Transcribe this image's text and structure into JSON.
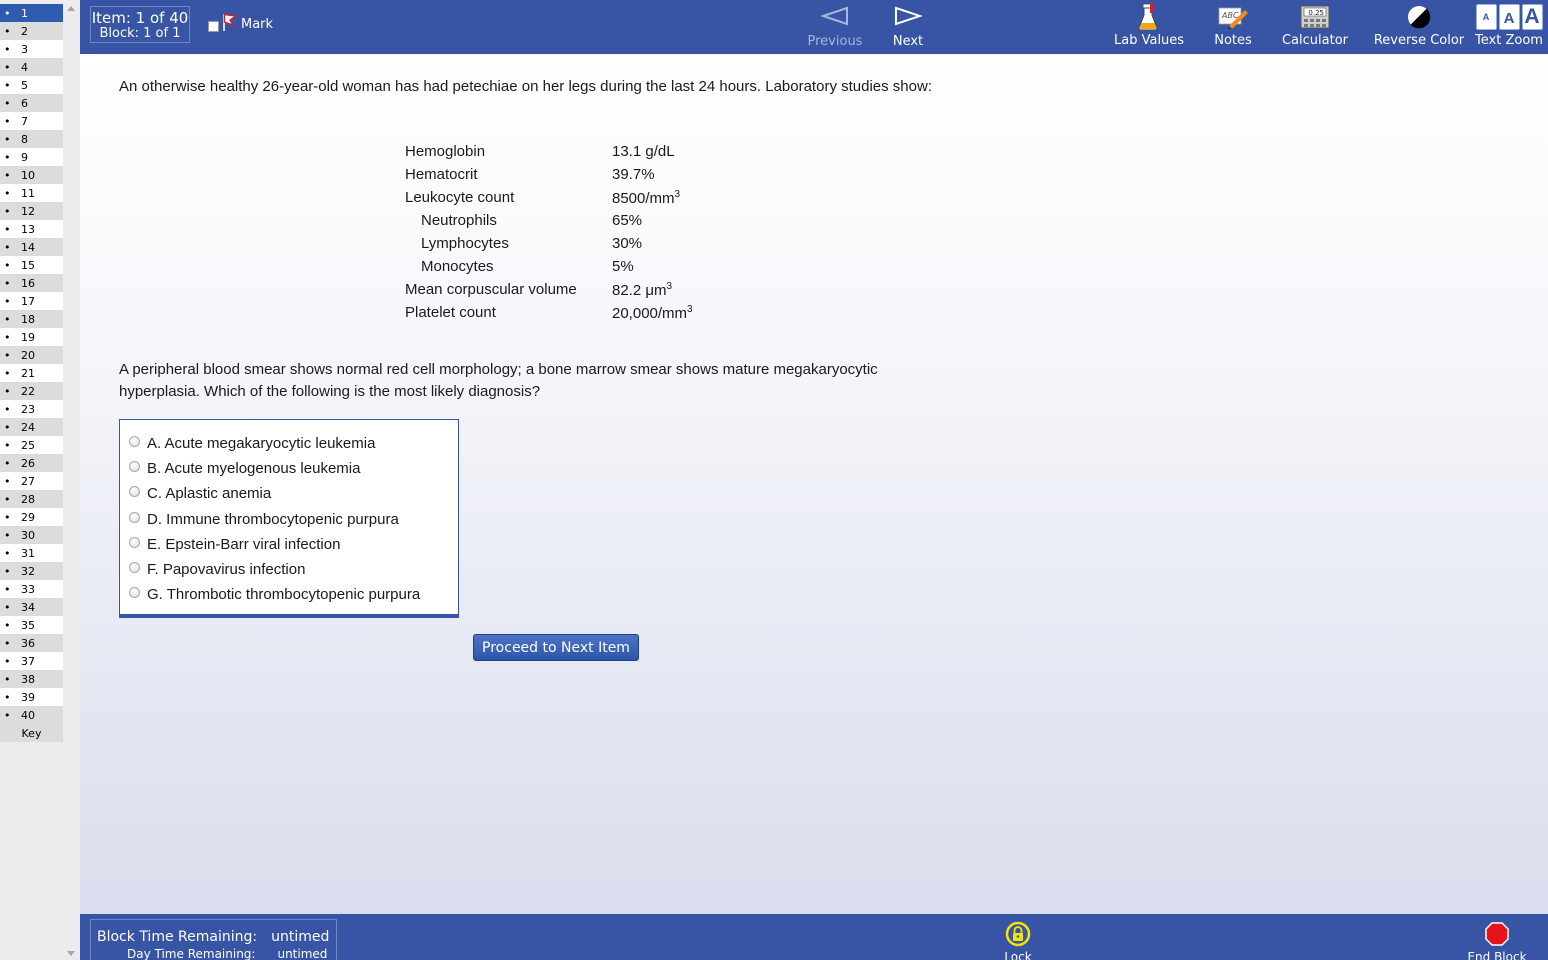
{
  "sidebar": {
    "items": [
      "1",
      "2",
      "3",
      "4",
      "5",
      "6",
      "7",
      "8",
      "9",
      "10",
      "11",
      "12",
      "13",
      "14",
      "15",
      "16",
      "17",
      "18",
      "19",
      "20",
      "21",
      "22",
      "23",
      "24",
      "25",
      "26",
      "27",
      "28",
      "29",
      "30",
      "31",
      "32",
      "33",
      "34",
      "35",
      "36",
      "37",
      "38",
      "39",
      "40"
    ],
    "active_item": "1",
    "key_label": "Key"
  },
  "header": {
    "item_label": "Item: 1 of 40",
    "block_label": "Block: 1 of 1",
    "mark_label": "Mark",
    "previous_label": "Previous",
    "next_label": "Next",
    "lab_values_label": "Lab Values",
    "notes_label": "Notes",
    "calculator_label": "Calculator",
    "calculator_display": "0.25",
    "reverse_color_label": "Reverse Color",
    "text_zoom_label": "Text Zoom",
    "zoom_small": "A",
    "zoom_medium": "A",
    "zoom_large": "A"
  },
  "question": {
    "stem": "An otherwise healthy 26-year-old woman has had petechiae on her legs during the last 24 hours. Laboratory studies show:",
    "labs": [
      {
        "name": "Hemoglobin",
        "value": "13.1 g/dL",
        "sup": "",
        "indent": false
      },
      {
        "name": "Hematocrit",
        "value": "39.7%",
        "sup": "",
        "indent": false
      },
      {
        "name": "Leukocyte count",
        "value": "8500/mm",
        "sup": "3",
        "indent": false
      },
      {
        "name": "Neutrophils",
        "value": "65%",
        "sup": "",
        "indent": true
      },
      {
        "name": "Lymphocytes",
        "value": "30%",
        "sup": "",
        "indent": true
      },
      {
        "name": "Monocytes",
        "value": "5%",
        "sup": "",
        "indent": true
      },
      {
        "name": "Mean corpuscular volume",
        "value": "82.2 μm",
        "sup": "3",
        "indent": false
      },
      {
        "name": "Platelet count",
        "value": "20,000/mm",
        "sup": "3",
        "indent": false
      }
    ],
    "prompt": "A peripheral blood smear shows normal red cell morphology; a bone marrow smear shows mature megakaryocytic hyperplasia. Which of the following is the most likely diagnosis?",
    "options": [
      "A. Acute megakaryocytic leukemia",
      "B. Acute myelogenous leukemia",
      "C. Aplastic anemia",
      "D. Immune thrombocytopenic purpura",
      "E. Epstein-Barr viral infection",
      "F. Papovavirus infection",
      "G. Thrombotic thrombocytopenic purpura"
    ],
    "proceed_label": "Proceed to Next Item"
  },
  "footer": {
    "block_time_label": "Block Time Remaining:",
    "block_time_value": "untimed",
    "day_time_label": "Day Time Remaining:",
    "day_time_value": "untimed",
    "lock_label": "Lock",
    "end_block_label": "End Block"
  },
  "colors": {
    "bar_blue": "#3754a5",
    "active_item": "#2e5bb0",
    "end_block_red": "#e8141c",
    "lock_yellow": "#f5e400"
  }
}
